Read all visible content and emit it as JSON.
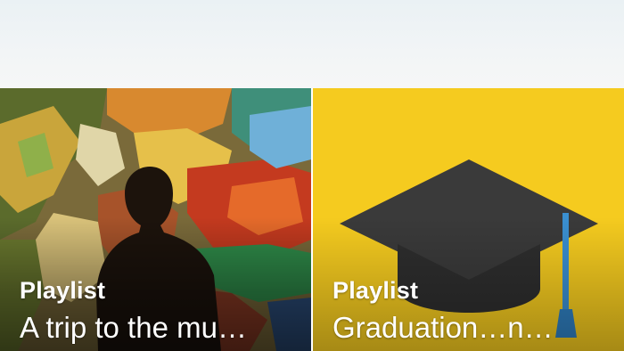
{
  "header": {},
  "tiles": [
    {
      "kind": "Playlist",
      "name": "A trip to the mu…",
      "art": "museum-painting-silhouette"
    },
    {
      "kind": "Playlist",
      "name": "Graduation…n…",
      "art": "graduation-cap-icon",
      "background": "#f5cb1f"
    }
  ],
  "colors": {
    "yellow_tile": "#f5cb1f",
    "cap": "#3a3a3a",
    "tassel": "#3a8fd0"
  }
}
